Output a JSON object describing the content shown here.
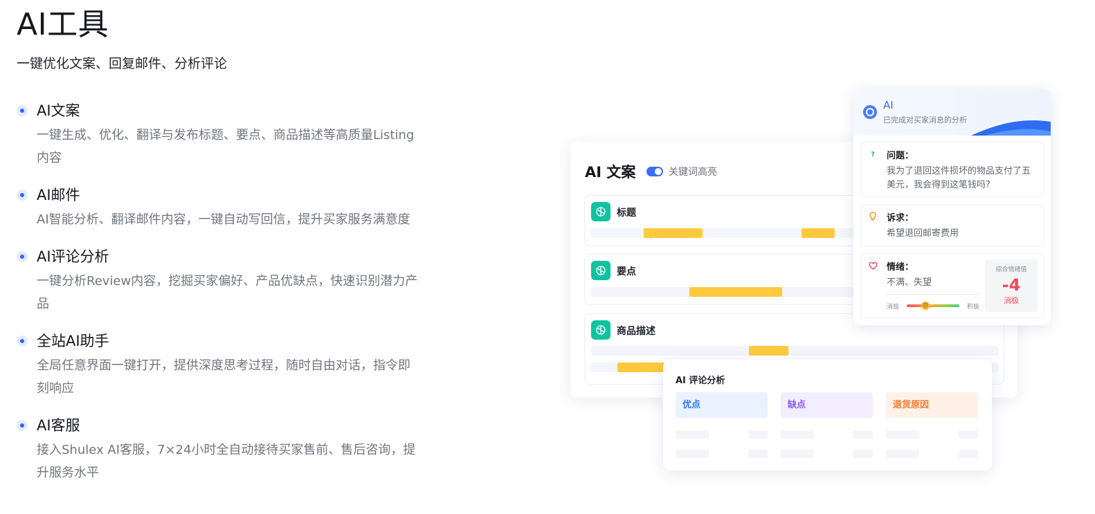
{
  "hero": {
    "title": "AI工具",
    "subtitle": "一键优化文案、回复邮件、分析评论"
  },
  "features": [
    {
      "title": "AI文案",
      "description": "一键生成、优化、翻译与发布标题、要点、商品描述等高质量Listing内容"
    },
    {
      "title": "AI邮件",
      "description": "AI智能分析、翻译邮件内容，一键自动写回信，提升买家服务满意度"
    },
    {
      "title": "AI评论分析",
      "description": "一键分析Review内容，挖掘买家偏好、产品优缺点，快速识别潜力产品"
    },
    {
      "title": "全站AI助手",
      "description": "全局任意界面一键打开，提供深度思考过程，随时自由对话，指令即刻响应"
    },
    {
      "title": "AI客服",
      "description": "接入Shulex AI客服，7×24小时全自动接待买家售前、售后咨询，提升服务水平"
    }
  ],
  "copy_card": {
    "title": "AI 文案",
    "toggle_label": "关键词高亮",
    "toggle_on": true,
    "highlight_color": "#ffc93e",
    "items": [
      {
        "label": "标题",
        "icon": "chatgpt-icon"
      },
      {
        "label": "要点",
        "icon": "chatgpt-icon"
      },
      {
        "label": "商品描述",
        "icon": "chatgpt-icon"
      }
    ]
  },
  "analysis_card": {
    "name": "AI",
    "status": "已完成对买家消息的分析",
    "question": {
      "title": "问题：",
      "text": "我为了退回这件损坏的物品支付了五美元，我会得到这笔钱吗?",
      "icon": "question-icon"
    },
    "request": {
      "title": "诉求：",
      "text": "希望退回邮寄费用",
      "icon": "lightbulb-icon"
    },
    "emotion": {
      "title": "情绪：",
      "text": "不满、失望",
      "icon": "heart-icon",
      "scale_negative": "消极",
      "scale_positive": "积极",
      "score_label": "综合情绪值",
      "score_value": "-4",
      "score_tag": "消极",
      "score_color": "#f2495a"
    }
  },
  "review_card": {
    "title": "AI 评论分析",
    "columns": [
      {
        "label": "优点",
        "color": "#2f74f0",
        "bg": "#eaf2ff"
      },
      {
        "label": "缺点",
        "color": "#8a5cf0",
        "bg": "#f2edff"
      },
      {
        "label": "退货原因",
        "color": "#f07a2f",
        "bg": "#fff1e8"
      }
    ]
  }
}
